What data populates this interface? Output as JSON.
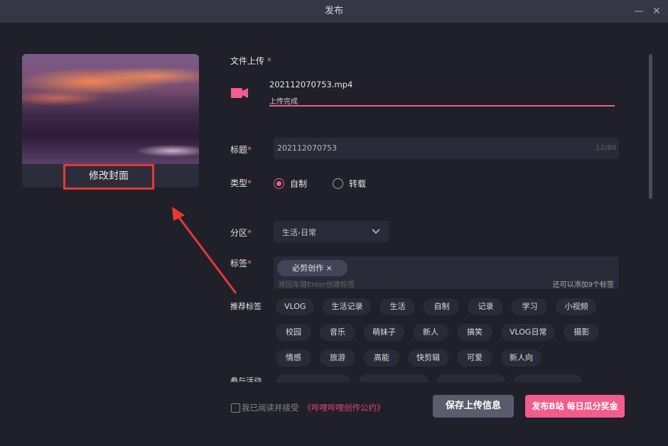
{
  "window": {
    "title": "发布",
    "minimize_icon": "minimize-icon",
    "close_icon": "close-icon"
  },
  "cover": {
    "change_label": "修改封面"
  },
  "upload": {
    "label": "文件上传",
    "required": "*",
    "file_name": "202112070753.mp4",
    "status": "上传完成",
    "progress": 100,
    "accent": "#f25d8e"
  },
  "title_field": {
    "label": "标题",
    "required": "*",
    "value": "202112070753",
    "counter": "12/80"
  },
  "type": {
    "label": "类型",
    "required": "*",
    "options": [
      {
        "label": "自制",
        "selected": true
      },
      {
        "label": "转载",
        "selected": false
      }
    ]
  },
  "category": {
    "label": "分区",
    "required": "*",
    "value": "生活-日常"
  },
  "tags": {
    "label": "标签",
    "required": "*",
    "chips": [
      "必剪创作 ×"
    ],
    "placeholder": "按回车键Enter创建标签",
    "remaining": "还可以添加9个标签"
  },
  "recommended": {
    "label": "推荐标签",
    "rows": [
      [
        "VLOG",
        "生活记录",
        "生活",
        "自制",
        "记录",
        "学习",
        "小视频"
      ],
      [
        "校园",
        "音乐",
        "萌妹子",
        "新人",
        "搞笑",
        "VLOG日常",
        "摄影"
      ],
      [
        "情感",
        "旅游",
        "高能",
        "快剪辑",
        "可爱",
        "新人向"
      ]
    ]
  },
  "activity": {
    "label": "参与活动"
  },
  "footer": {
    "agree_text": "我已阅读并接受",
    "agreement_link": "《哔哩哔哩创作公约》",
    "save_label": "保存上传信息",
    "publish_label": "发布B站 每日瓜分奖金"
  }
}
